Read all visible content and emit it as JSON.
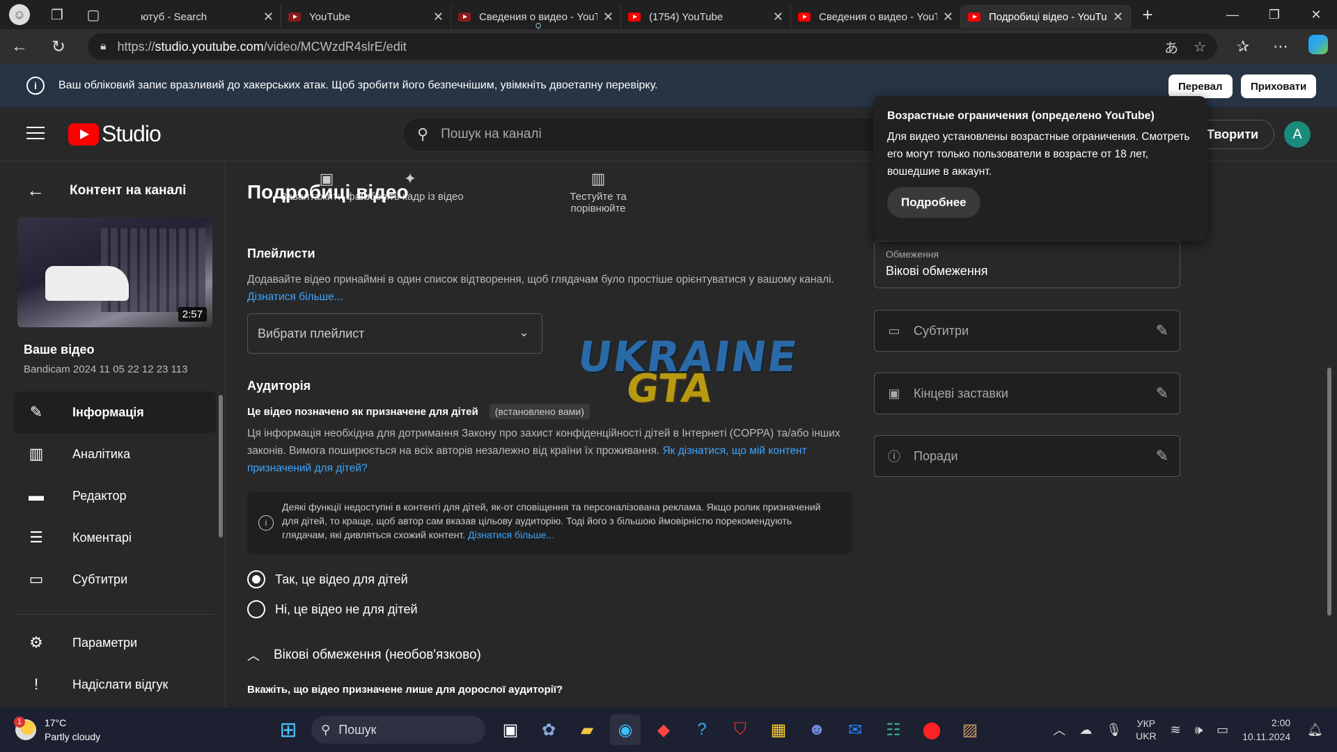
{
  "browser": {
    "tabs": [
      {
        "title": "ютуб - Search",
        "kind": "search"
      },
      {
        "title": "YouTube",
        "kind": "dim"
      },
      {
        "title": "Сведения о видео - YouT",
        "kind": "dim"
      },
      {
        "title": "(1754) YouTube",
        "kind": "yt"
      },
      {
        "title": "Сведения о видео - YouT",
        "kind": "yt"
      },
      {
        "title": "Подробиці відео - YouTu",
        "kind": "yt"
      }
    ],
    "url_prefix": "https://",
    "url_host": "studio.youtube.com",
    "url_path": "/video/MCWzdR4slrE/edit"
  },
  "infobar": {
    "text": "Ваш обліковий запис вразливий до хакерських атак. Щоб зробити його безпечнішим, увімкніть двоетапну перевірку.",
    "btn_check": "Перевал",
    "btn_hide": "Приховати"
  },
  "header": {
    "logo_text": "Studio",
    "search_placeholder": "Пошук на каналі",
    "create_label": "Творити",
    "account_initial": "A"
  },
  "sidebar": {
    "back_label": "Контент на каналі",
    "video_duration": "2:57",
    "your_video": "Ваше відео",
    "video_name": "Bandicam 2024 11 05 22 12 23 113",
    "items": [
      {
        "label": "Інформація",
        "icon": "pencil-icon",
        "glyph": "✎"
      },
      {
        "label": "Аналітика",
        "icon": "analytics-icon",
        "glyph": "▥"
      },
      {
        "label": "Редактор",
        "icon": "clapper-icon",
        "glyph": "▬"
      },
      {
        "label": "Коментарі",
        "icon": "comments-icon",
        "glyph": "☰"
      },
      {
        "label": "Субтитри",
        "icon": "subtitles-icon",
        "glyph": "▭"
      }
    ],
    "bottom_items": [
      {
        "label": "Параметри",
        "icon": "gear-icon",
        "glyph": "⚙"
      },
      {
        "label": "Надіслати відгук",
        "icon": "feedback-icon",
        "glyph": "!"
      }
    ]
  },
  "main": {
    "title": "Подробиці відео",
    "ghost_tools": [
      {
        "label": "Завантажити файл",
        "glyph": "▣"
      },
      {
        "label": "Виберіть кадр із відео",
        "glyph": "✦"
      },
      {
        "label": "Тестуйте та порівнюйте",
        "glyph": "▥"
      }
    ],
    "playlists_h": "Плейлисти",
    "playlists_p": "Додавайте відео принаймні в один список відтворення, щоб глядачам було простіше орієнтуватися у вашому каналі.",
    "playlists_link": "Дізнатися більше...",
    "playlist_select": "Вибрати плейлист",
    "audience_h": "Аудиторія",
    "audience_status": "Це відео позначено як призначене для дітей",
    "audience_tag": "(встановлено вами)",
    "audience_p": "Ця інформація необхідна для дотримання Закону про захист конфіденційності дітей в Інтернеті (COPPA) та/або інших законів. Вимога поширюється на всіх авторів незалежно від країни їх проживання.",
    "audience_link": "Як дізнатися, що мій контент призначений для дітей?",
    "notice_text": "Деякі функції недоступні в контенті для дітей, як-от сповіщення та персоналізована реклама. Якщо ролик призначений для дітей, то краще, щоб автор сам вказав цільову аудиторію. Тоді його з більшою ймовірністю порекомендують глядачам, які дивляться схожий контент.",
    "notice_link": "Дізнатися більше...",
    "radio_yes": "Так, це відео для дітей",
    "radio_no": "Ні, це відео не для дітей",
    "age_toggle": "Вікові обмеження (необов'язково)",
    "adult_q": "Вкажіть, що відео призначене лише для дорослої аудиторії?"
  },
  "watermark": {
    "top": "UKRAINE",
    "bottom": "GTA"
  },
  "right": {
    "restr_label": "Обмеження",
    "restr_value": "Вікові обмеження",
    "cards": [
      {
        "label": "Субтитри",
        "icon": "subtitles-icon",
        "glyph": "▭"
      },
      {
        "label": "Кінцеві заставки",
        "icon": "endscreen-icon",
        "glyph": "▣"
      },
      {
        "label": "Поради",
        "icon": "info-icon",
        "glyph": "ⓘ"
      }
    ]
  },
  "tooltip": {
    "title": "Возрастные ограничения (определено YouTube)",
    "text": "Для видео установлены возрастные ограничения. Смотреть его могут только пользователи в возрасте от 18 лет, вошедшие в аккаунт.",
    "button": "Подробнее"
  },
  "taskbar": {
    "temp": "17°C",
    "weather": "Partly cloudy",
    "weather_badge": "1",
    "search": "Пошук",
    "lang1": "УКР",
    "lang2": "UKR",
    "time": "2:00",
    "date": "10.11.2024"
  }
}
